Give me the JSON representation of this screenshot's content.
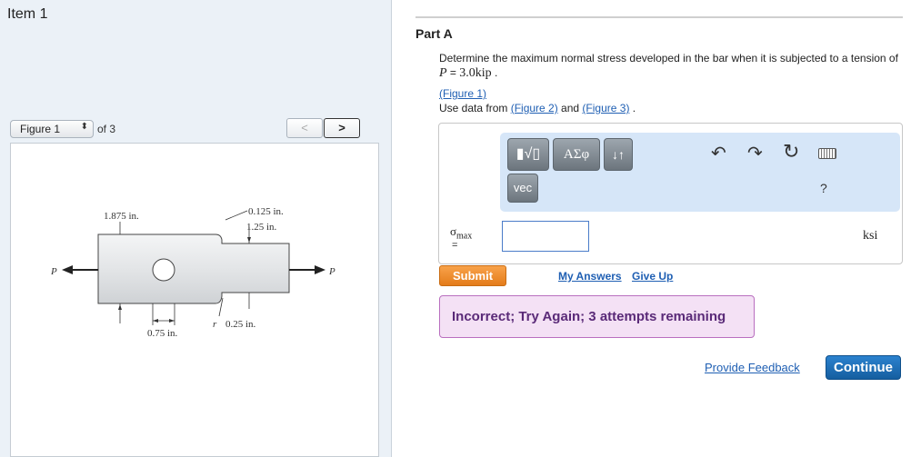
{
  "item": {
    "title": "Item 1"
  },
  "figure_nav": {
    "select_value": "Figure 1",
    "of_text": "of 3",
    "prev_label": "<",
    "next_label": ">"
  },
  "figure": {
    "dim_1875": "1.875 in.",
    "dim_0125": "0.125 in.",
    "dim_125": "1.25 in.",
    "dim_075": "0.75 in.",
    "r_label": "r",
    "dim_025": "0.25 in.",
    "load_left": "P",
    "load_right": "P"
  },
  "part": {
    "title": "Part A"
  },
  "problem": {
    "text_before": "Determine the maximum normal stress developed in the bar when it is subjected to a tension of ",
    "var_P": "P",
    "equals": " = ",
    "value": "3.0kip",
    "period": " .",
    "fig1_link": "(Figure 1)",
    "use_data_text": "Use data from ",
    "fig2_link": "(Figure 2)",
    "and_text": " and ",
    "fig3_link": "(Figure 3)",
    "end_text": " ."
  },
  "toolbar": {
    "templates_label": "▮√▯",
    "greek_label": "ΑΣφ",
    "sort_label": "↓↑",
    "vec_label": "vec",
    "undo_icon": "undo-icon",
    "redo_icon": "redo-icon",
    "reset_icon": "reset-icon",
    "keyboard_icon": "keyboard-icon",
    "help_label": "?"
  },
  "answer": {
    "sigma": "σ",
    "sigma_sub": "max",
    "eq": "=",
    "value": "",
    "unit": "ksi"
  },
  "actions": {
    "submit_label": "Submit",
    "my_answers_label": "My Answers",
    "give_up_label": "Give Up"
  },
  "feedback": {
    "message": "Incorrect; Try Again; 3 attempts remaining"
  },
  "footer": {
    "provide_feedback_label": "Provide Feedback",
    "continue_label": "Continue"
  },
  "colors": {
    "left_panel_bg": "#ebf1f7",
    "tool_panel_bg": "#d6e6f8",
    "submit_orange": "#e47c1a",
    "feedback_bg": "#f4e1f5",
    "continue_blue": "#155e9f",
    "link_blue": "#1f5fb3"
  }
}
